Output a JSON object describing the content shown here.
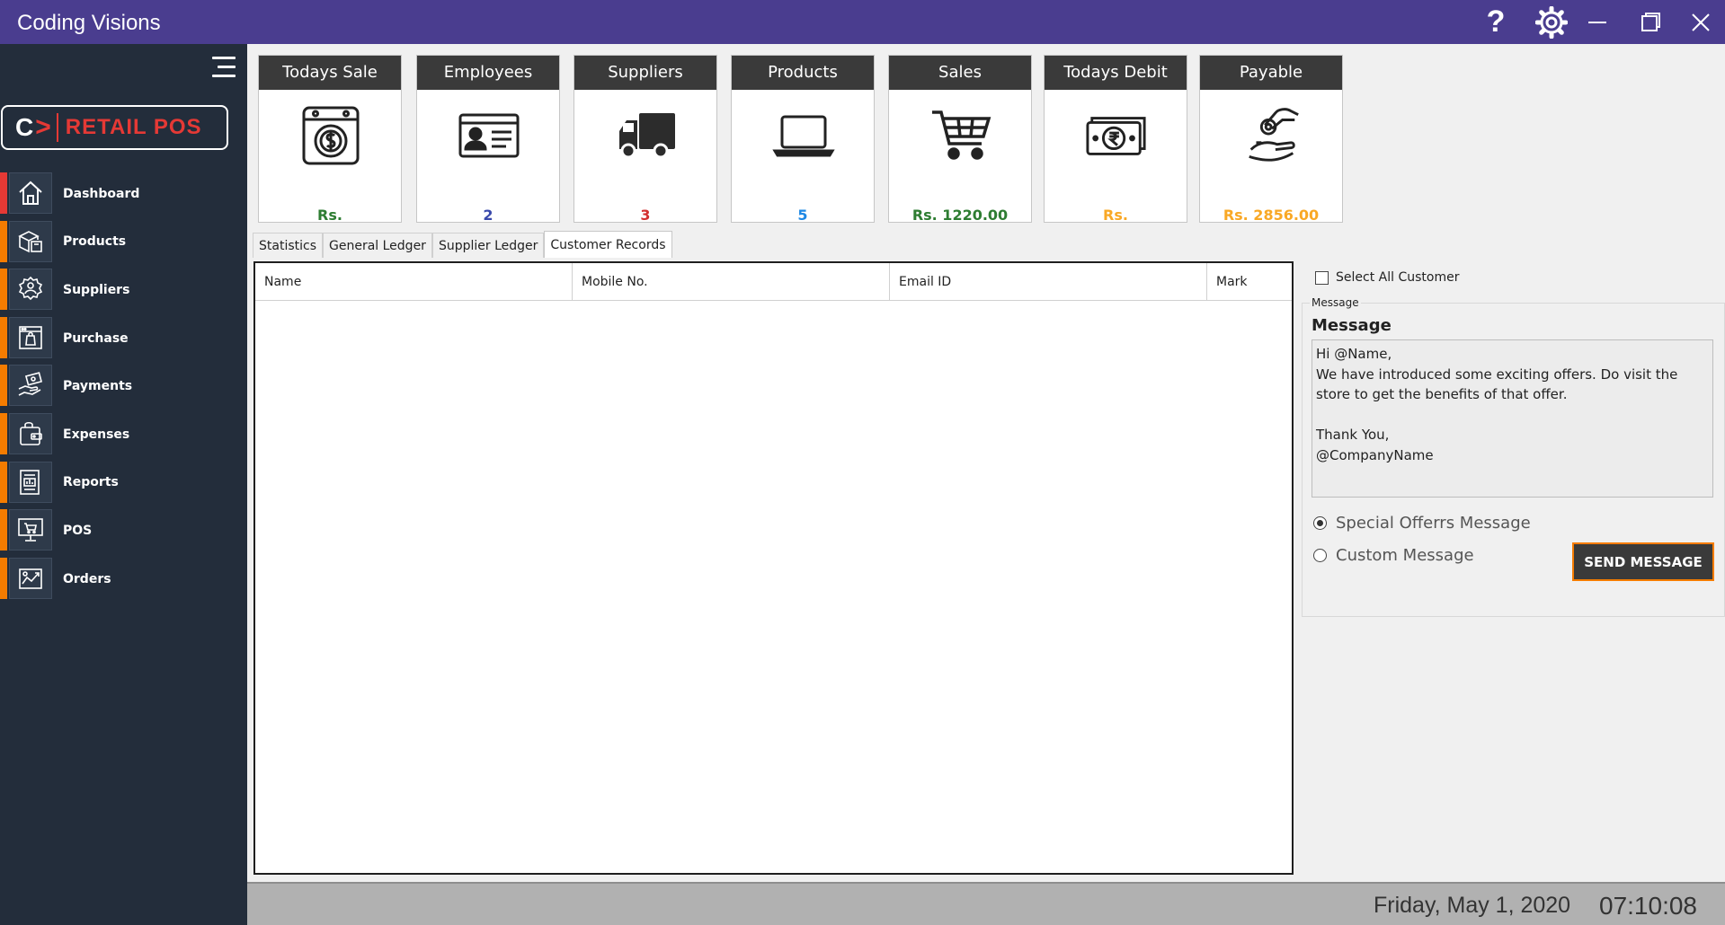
{
  "window": {
    "title": "Coding Visions",
    "help_symbol": "?",
    "controls": [
      "help-icon",
      "settings-gear-icon",
      "minimize-icon",
      "maximize-icon",
      "close-icon"
    ]
  },
  "sidebar": {
    "logo": {
      "mark": "C",
      "arrow": ">",
      "text": "RETAIL POS"
    },
    "items": [
      {
        "label": "Dashboard",
        "icon": "home-icon",
        "active": true
      },
      {
        "label": "Products",
        "icon": "boxes-icon"
      },
      {
        "label": "Suppliers",
        "icon": "supplier-badge-icon"
      },
      {
        "label": "Purchase",
        "icon": "purchase-icon"
      },
      {
        "label": "Payments",
        "icon": "payment-hand-icon"
      },
      {
        "label": "Expenses",
        "icon": "wallet-icon"
      },
      {
        "label": "Reports",
        "icon": "report-icon"
      },
      {
        "label": "POS",
        "icon": "pos-monitor-icon"
      },
      {
        "label": "Orders",
        "icon": "orders-chart-icon"
      }
    ]
  },
  "cards": [
    {
      "title": "Todays Sale",
      "value": "Rs.",
      "color": "#2e7d32",
      "icon": "dollar-safe-icon"
    },
    {
      "title": "Employees",
      "value": "2",
      "color": "#3949ab",
      "icon": "id-card-icon"
    },
    {
      "title": "Suppliers",
      "value": "3",
      "color": "#d32f2f",
      "icon": "truck-icon"
    },
    {
      "title": "Products",
      "value": "5",
      "color": "#1e88e5",
      "icon": "laptop-icon"
    },
    {
      "title": "Sales",
      "value": "Rs. 1220.00",
      "color": "#2e7d32",
      "icon": "cart-icon"
    },
    {
      "title": "Todays Debit",
      "value": "Rs.",
      "color": "#f9a825",
      "icon": "rupee-cash-icon"
    },
    {
      "title": "Payable",
      "value": "Rs. 2856.00",
      "color": "#f9a825",
      "icon": "hand-coin-icon"
    }
  ],
  "tabs": [
    {
      "label": "Statistics"
    },
    {
      "label": "General Ledger"
    },
    {
      "label": "Supplier Ledger"
    },
    {
      "label": "Customer Records",
      "active": true
    }
  ],
  "grid": {
    "columns": [
      "Name",
      "Mobile No.",
      "Email ID",
      "Mark"
    ],
    "rows": []
  },
  "panel": {
    "select_all_label": "Select All Customer",
    "select_all_checked": false,
    "group_legend": "Message",
    "message_label": "Message",
    "message_text": "Hi @Name,\nWe have introduced some exciting offers. Do visit the store to get the benefits of that offer.\n\nThank You,\n@CompanyName",
    "radio_special": "Special Offerrs Message",
    "radio_custom": "Custom Message",
    "selected_radio": "special",
    "send_label": "SEND MESSAGE"
  },
  "status": {
    "date": "Friday, May 1, 2020",
    "time": "07:10:08"
  }
}
